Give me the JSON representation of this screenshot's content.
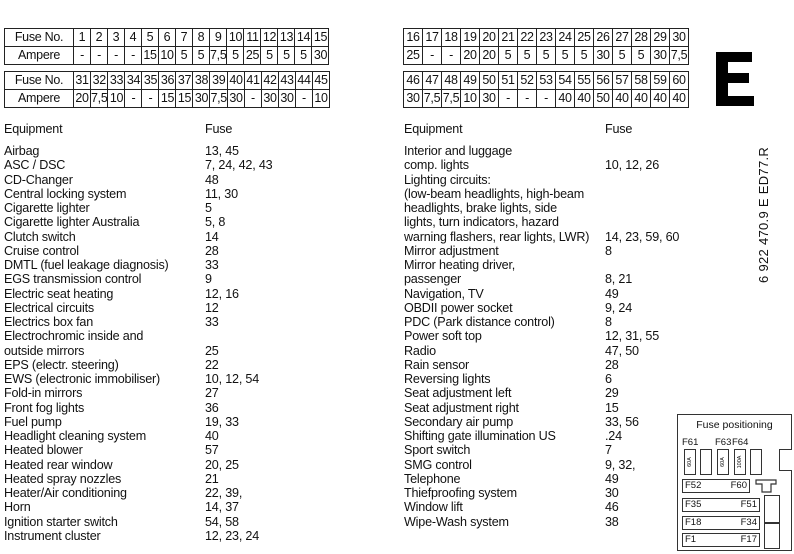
{
  "fuse_tables": {
    "row_label_fuse": "Fuse No.",
    "row_label_ampere": "Ampere",
    "left_top": {
      "fuses": [
        "1",
        "2",
        "3",
        "4",
        "5",
        "6",
        "7",
        "8",
        "9",
        "10",
        "11",
        "12",
        "13",
        "14",
        "15"
      ],
      "amperes": [
        "-",
        "-",
        "-",
        "-",
        "15",
        "10",
        "5",
        "5",
        "7,5",
        "5",
        "25",
        "5",
        "5",
        "5",
        "30"
      ]
    },
    "left_bottom": {
      "fuses": [
        "31",
        "32",
        "33",
        "34",
        "35",
        "36",
        "37",
        "38",
        "39",
        "40",
        "41",
        "42",
        "43",
        "44",
        "45"
      ],
      "amperes": [
        "20",
        "7,5",
        "10",
        "-",
        "-",
        "15",
        "15",
        "30",
        "7,5",
        "30",
        "-",
        "30",
        "30",
        "-",
        "10"
      ]
    },
    "right_top": {
      "fuses": [
        "16",
        "17",
        "18",
        "19",
        "20",
        "21",
        "22",
        "23",
        "24",
        "25",
        "26",
        "27",
        "28",
        "29",
        "30"
      ],
      "amperes": [
        "25",
        "-",
        "-",
        "20",
        "20",
        "5",
        "5",
        "5",
        "5",
        "5",
        "30",
        "5",
        "5",
        "30",
        "7,5"
      ]
    },
    "right_bottom": {
      "fuses": [
        "46",
        "47",
        "48",
        "49",
        "50",
        "51",
        "52",
        "53",
        "54",
        "55",
        "56",
        "57",
        "58",
        "59",
        "60"
      ],
      "amperes": [
        "30",
        "7,5",
        "7,5",
        "10",
        "30",
        "-",
        "-",
        "-",
        "40",
        "40",
        "50",
        "40",
        "40",
        "40",
        "40"
      ]
    }
  },
  "section_letter": "E",
  "document_code": "6 922 470.9 E ED77.R",
  "list_headers": {
    "equipment": "Equipment",
    "fuse": "Fuse"
  },
  "equipment_left": [
    {
      "equipment": "Airbag",
      "fuse": "13, 45"
    },
    {
      "equipment": "ASC / DSC",
      "fuse": "7, 24, 42, 43"
    },
    {
      "equipment": "CD-Changer",
      "fuse": "48"
    },
    {
      "equipment": "Central locking system",
      "fuse": "11, 30"
    },
    {
      "equipment": "Cigarette lighter",
      "fuse": "5"
    },
    {
      "equipment": "Cigarette lighter Australia",
      "fuse": "5, 8"
    },
    {
      "equipment": "Clutch switch",
      "fuse": "14"
    },
    {
      "equipment": "Cruise control",
      "fuse": "28"
    },
    {
      "equipment": "DMTL (fuel leakage diagnosis)",
      "fuse": "33"
    },
    {
      "equipment": "EGS transmission control",
      "fuse": "9"
    },
    {
      "equipment": "Electric seat heating",
      "fuse": "12, 16"
    },
    {
      "equipment": "Electrical circuits",
      "fuse": "12"
    },
    {
      "equipment": "Electrics box fan",
      "fuse": "33"
    },
    {
      "equipment": "Electrochromic inside and",
      "fuse": ""
    },
    {
      "equipment": "outside mirrors",
      "fuse": "25"
    },
    {
      "equipment": "EPS (electr. steering)",
      "fuse": "22"
    },
    {
      "equipment": "EWS (electronic immobiliser)",
      "fuse": "10, 12, 54"
    },
    {
      "equipment": "Fold-in mirrors",
      "fuse": "27"
    },
    {
      "equipment": "Front fog lights",
      "fuse": "36"
    },
    {
      "equipment": "Fuel pump",
      "fuse": "19, 33"
    },
    {
      "equipment": "Headlight cleaning system",
      "fuse": "40"
    },
    {
      "equipment": "Heated blower",
      "fuse": "57"
    },
    {
      "equipment": "Heated rear window",
      "fuse": "20, 25"
    },
    {
      "equipment": "Heated spray nozzles",
      "fuse": "21"
    },
    {
      "equipment": "Heater/Air conditioning",
      "fuse": "22, 39,"
    },
    {
      "equipment": "Horn",
      "fuse": "14, 37"
    },
    {
      "equipment": "Ignition starter switch",
      "fuse": "54, 58"
    },
    {
      "equipment": "Instrument cluster",
      "fuse": "12, 23, 24"
    }
  ],
  "equipment_right": [
    {
      "equipment": "Interior and luggage",
      "fuse": ""
    },
    {
      "equipment": "comp. lights",
      "fuse": "10, 12, 26"
    },
    {
      "equipment": "Lighting circuits:",
      "fuse": ""
    },
    {
      "equipment": "(low-beam headlights, high-beam",
      "fuse": ""
    },
    {
      "equipment": "headlights, brake lights, side",
      "fuse": ""
    },
    {
      "equipment": "lights, turn indicators, hazard",
      "fuse": ""
    },
    {
      "equipment": "warning flashers, rear lights, LWR)",
      "fuse": "14, 23, 59, 60"
    },
    {
      "equipment": "Mirror adjustment",
      "fuse": "8"
    },
    {
      "equipment": "Mirror heating driver,",
      "fuse": ""
    },
    {
      "equipment": "passenger",
      "fuse": "8, 21"
    },
    {
      "equipment": "Navigation, TV",
      "fuse": "49"
    },
    {
      "equipment": "OBDII power socket",
      "fuse": "9, 24"
    },
    {
      "equipment": "PDC (Park distance control)",
      "fuse": "8"
    },
    {
      "equipment": "Power soft top",
      "fuse": "12, 31, 55"
    },
    {
      "equipment": "Radio",
      "fuse": "47, 50"
    },
    {
      "equipment": "Rain sensor",
      "fuse": "28"
    },
    {
      "equipment": "Reversing lights",
      "fuse": "6"
    },
    {
      "equipment": "Seat adjustment left",
      "fuse": "29"
    },
    {
      "equipment": "Seat adjustment right",
      "fuse": "15"
    },
    {
      "equipment": "Secondary air pump",
      "fuse": "33, 56"
    },
    {
      "equipment": "Shifting gate illumination US",
      "fuse": ".24"
    },
    {
      "equipment": "Sport switch",
      "fuse": "7"
    },
    {
      "equipment": "SMG control",
      "fuse": "9, 32,"
    },
    {
      "equipment": "Telephone",
      "fuse": "49"
    },
    {
      "equipment": "Thiefproofing system",
      "fuse": "30"
    },
    {
      "equipment": "Window lift",
      "fuse": "46"
    },
    {
      "equipment": "Wipe-Wash system",
      "fuse": "38"
    }
  ],
  "fuse_positioning": {
    "title": "Fuse positioning",
    "labels": {
      "f61": "F61",
      "f63": "F63",
      "f64": "F64"
    },
    "slot_amps": {
      "f61": "60A",
      "f63": "60A",
      "f64": "100A"
    },
    "strips": [
      {
        "left": "F52",
        "right": "F60"
      },
      {
        "left": "F35",
        "right": "F51"
      },
      {
        "left": "F18",
        "right": "F34"
      },
      {
        "left": "F1",
        "right": "F17"
      }
    ]
  }
}
